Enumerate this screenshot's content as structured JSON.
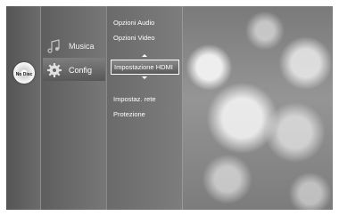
{
  "disc": {
    "label": "No Disc",
    "icon": "disc-icon"
  },
  "main_menu": {
    "items": [
      {
        "label": "Musica",
        "icon": "music-note-icon"
      },
      {
        "label": "Config",
        "icon": "gear-icon",
        "selected": true
      }
    ]
  },
  "submenu": {
    "items": [
      {
        "label": "Opzioni Audio"
      },
      {
        "label": "Opzioni Video"
      },
      {
        "label": "Impostazione HDMI",
        "selected": true
      },
      {
        "label": "Impostaz. rete"
      },
      {
        "label": "Protezione"
      }
    ]
  }
}
